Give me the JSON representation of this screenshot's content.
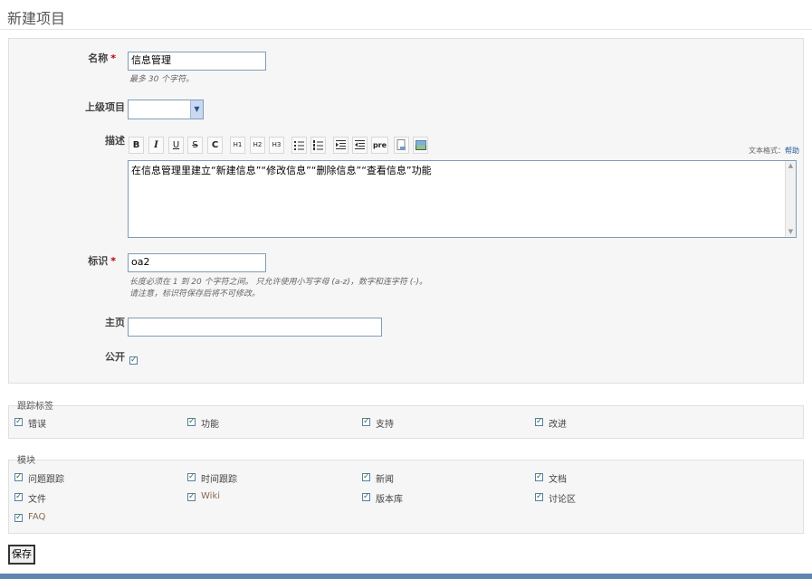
{
  "page": {
    "title": "新建项目"
  },
  "form": {
    "name": {
      "label": "名称",
      "required_mark": "*",
      "value": "信息管理",
      "hint": "最多 30 个字符。"
    },
    "parent": {
      "label": "上级项目",
      "value": ""
    },
    "description": {
      "label": "描述",
      "text": "在信息管理里建立“新建信息”“修改信息”“删除信息”“查看信息”功能",
      "format_label": "文本格式：",
      "help_link": "帮助",
      "toolbar": [
        "B",
        "I",
        "U",
        "S",
        "C",
        "H1",
        "H2",
        "H3",
        "ul",
        "ol",
        "indent-right",
        "indent-left",
        "pre",
        "link",
        "image"
      ]
    },
    "identifier": {
      "label": "标识",
      "required_mark": "*",
      "value": "oa2",
      "hint_line1": "长度必须在 1 到 20 个字符之间。 只允许使用小写字母 (a-z)，数字和连字符 (-)。",
      "hint_line2": "请注意，标识符保存后将不可修改。"
    },
    "homepage": {
      "label": "主页",
      "value": ""
    },
    "public": {
      "label": "公开",
      "checked": true
    }
  },
  "trackers": {
    "legend": "跟踪标签",
    "items": [
      {
        "label": "错误",
        "checked": true
      },
      {
        "label": "功能",
        "checked": true
      },
      {
        "label": "支持",
        "checked": true
      },
      {
        "label": "改进",
        "checked": true
      }
    ]
  },
  "modules": {
    "legend": "模块",
    "items": [
      {
        "label": "问题跟踪",
        "checked": true
      },
      {
        "label": "时间跟踪",
        "checked": true
      },
      {
        "label": "新闻",
        "checked": true
      },
      {
        "label": "文档",
        "checked": true
      },
      {
        "label": "文件",
        "checked": true
      },
      {
        "label": "Wiki",
        "checked": true
      },
      {
        "label": "版本库",
        "checked": true
      },
      {
        "label": "讨论区",
        "checked": true
      },
      {
        "label": "FAQ",
        "checked": true
      }
    ]
  },
  "actions": {
    "save_label": "保存"
  }
}
